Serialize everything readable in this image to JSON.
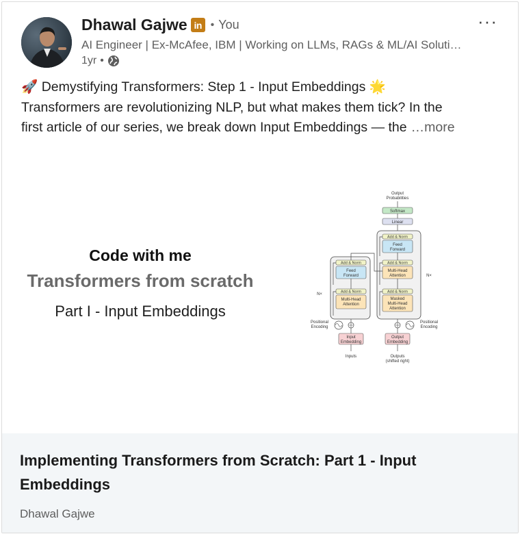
{
  "author": {
    "name": "Dhawal Gajwe",
    "badge": "in",
    "relation": "You",
    "headline": "AI Engineer | Ex-McAfee, IBM | Working on LLMs, RAGs & ML/AI Solutions",
    "time": "1yr",
    "separator": "•"
  },
  "post": {
    "line1": "🚀 Demystifying Transformers: Step 1 - Input Embeddings 🌟",
    "line2": "Transformers are revolutionizing NLP, but what makes them tick? In the",
    "line3": "first article of our series, we break down Input Embeddings — the",
    "see_more": "…more"
  },
  "image": {
    "title1": "Code with me",
    "title2": "Transformers from scratch",
    "title3": "Part I - Input Embeddings",
    "diagram": {
      "output_probabilities_1": "Output",
      "output_probabilities_2": "Probabilities",
      "softmax": "Softmax",
      "linear": "Linear",
      "add_norm": "Add & Norm",
      "feed_1": "Feed",
      "feed_2": "Forward",
      "mha_1": "Multi-Head",
      "mha_2": "Attention",
      "masked_1": "Masked",
      "nx": "N×",
      "positional_1": "Positional",
      "positional_2": "Encoding",
      "input_1": "Input",
      "input_2": "Embedding",
      "output_1": "Output",
      "inputs": "Inputs",
      "outputs_1": "Outputs",
      "outputs_2": "(shifted right)"
    }
  },
  "link": {
    "title": "Implementing Transformers from Scratch: Part 1 - Input Embeddings",
    "subtitle": "Dhawal Gajwe"
  },
  "menu": {
    "label": "···"
  },
  "colors": {
    "badge": "#c37d16",
    "footer_bg": "#f3f6f8",
    "ff_block": "#c8e6f5",
    "attn_block": "#fce4b8",
    "addnorm_block": "#f1f3c7",
    "embed_block": "#f7d1d3"
  }
}
